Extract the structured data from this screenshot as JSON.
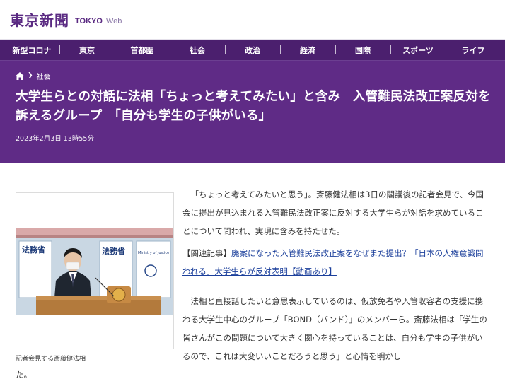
{
  "header": {
    "logo_jp": "東京新聞",
    "logo_en": "TOKYO",
    "logo_web": "Web"
  },
  "nav": [
    "新型コロナ",
    "東京",
    "首都圏",
    "社会",
    "政治",
    "経済",
    "国際",
    "スポーツ",
    "ライフ"
  ],
  "breadcrumb": {
    "section": "社会"
  },
  "article": {
    "title": "大学生らとの対話に法相「ちょっと考えてみたい」と含み　入管難民法改正案反対を訴えるグループ　「自分も学生の子供がいる」",
    "date": "2023年2月3日 13時55分",
    "photo_caption": "記者会見する斎藤健法相",
    "photo_signs": [
      "法務省",
      "法務省",
      "Ministry of Justice"
    ],
    "para1": "「ちょっと考えてみたいと思う」。斎藤健法相は3日の閣議後の記者会見で、今国会に提出が見込まれる入管難民法改正案に反対する大学生らが対話を求めていることについて問われ、実現に含みを持たせた。",
    "related_label": "【関連記事】",
    "related_link": "廃案になった入管難民法改正案をなぜまた提出？「日本の人権意識問われる」大学生らが反対表明【動画あり】",
    "para2": "法相と直接話したいと意思表示しているのは、仮放免者や入管収容者の支援に携わる大学生中心のグループ「BOND（バンド）」のメンバーら。斎藤法相は「学生の皆さんがこの問題について大きく関心を持っていることは、自分も学生の子供がいるので、これは大変いいことだろうと思う」と心情を明かし",
    "para2_tail": "た。"
  },
  "colors": {
    "nav_bg": "#4b1f6e",
    "hero_bg": "#5f2b86",
    "link": "#1b3f9b",
    "logo": "#5a2a82"
  }
}
